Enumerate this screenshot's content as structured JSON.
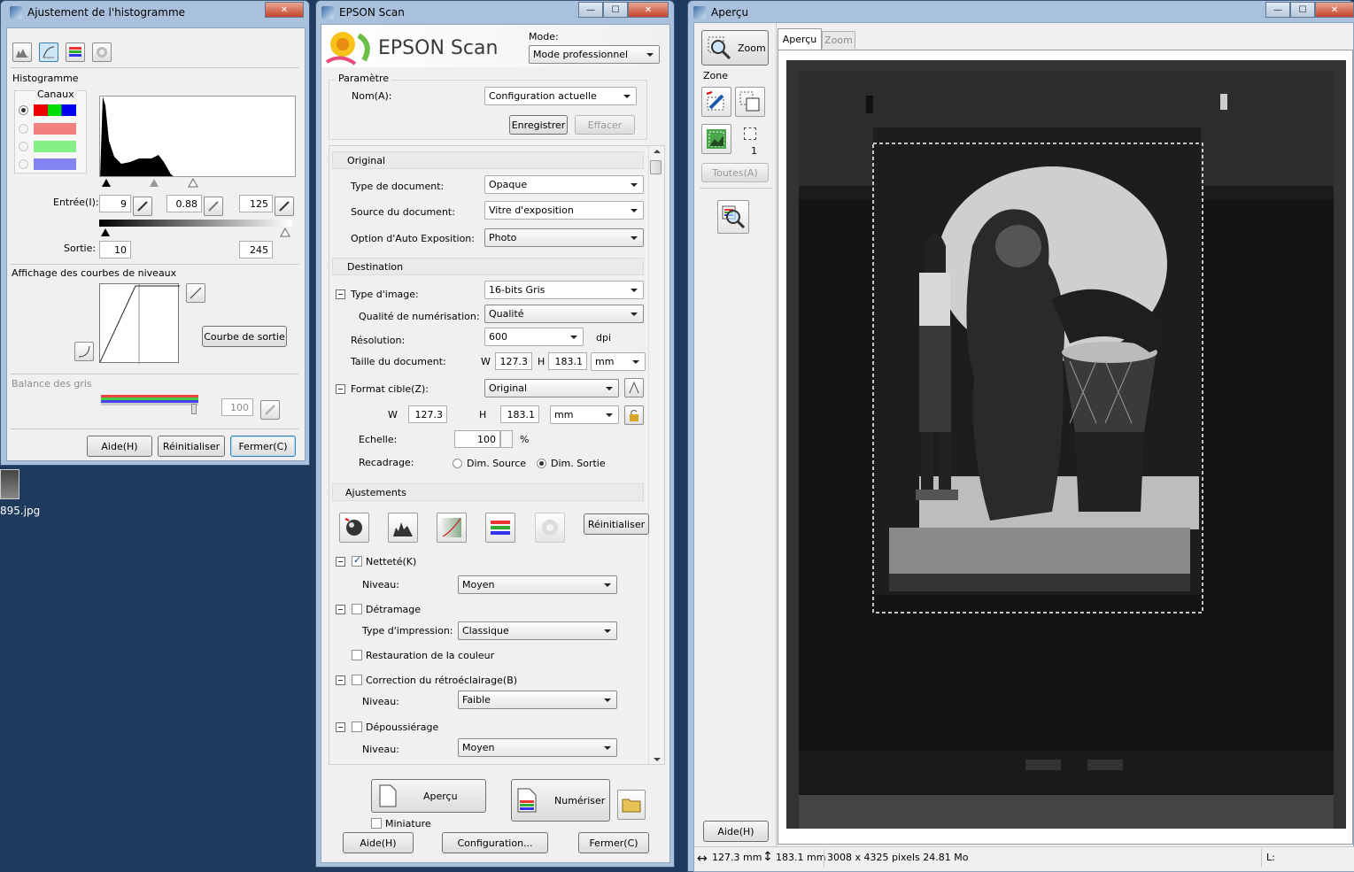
{
  "hist_window": {
    "title": "Ajustement de l'histogramme",
    "close_symbol": "✕",
    "toolbar_icons": [
      "histogram-icon",
      "tone-curve-icon",
      "color-balance-icon",
      "saturation-icon"
    ],
    "histogram_label": "Histogramme",
    "channels_label": "Canaux",
    "input_label": "Entrée(I):",
    "input_values": {
      "shadow": "9",
      "gamma": "0.88",
      "highlight": "125"
    },
    "output_label": "Sortie:",
    "output_values": {
      "low": "10",
      "high": "245"
    },
    "curve_section_label": "Affichage des courbes de niveaux",
    "output_curve_button": "Courbe de sortie",
    "gray_balance_label": "Balance des gris",
    "gray_balance_value": "100",
    "buttons": {
      "help": "Aide(H)",
      "reset": "Réinitialiser",
      "close": "Fermer(C)"
    }
  },
  "desktop": {
    "file_label": "895.jpg"
  },
  "epson_window": {
    "title": "EPSON Scan",
    "controls": {
      "minimize": "—",
      "maximize": "☐",
      "close": "✕"
    },
    "logo_text": "EPSON Scan",
    "mode_label": "Mode:",
    "mode_value": "Mode professionnel",
    "param_label": "Paramètre",
    "name_label": "Nom(A):",
    "name_value": "Configuration actuelle",
    "save_button": "Enregistrer",
    "delete_button": "Effacer",
    "original_section": "Original",
    "doc_type_label": "Type de document:",
    "doc_type_value": "Opaque",
    "doc_source_label": "Source du document:",
    "doc_source_value": "Vitre d'exposition",
    "auto_exposure_label": "Option d'Auto Exposition:",
    "auto_exposure_value": "Photo",
    "destination_section": "Destination",
    "image_type_label": "Type d'image:",
    "image_type_value": "16-bits Gris",
    "scan_quality_label": "Qualité de numérisation:",
    "scan_quality_value": "Qualité",
    "resolution_label": "Résolution:",
    "resolution_value": "600",
    "resolution_unit": "dpi",
    "doc_size_label": "Taille du document:",
    "w_label": "W",
    "h_label": "H",
    "doc_w": "127.3",
    "doc_h": "183.1",
    "unit_value": "mm",
    "target_format_label": "Format cible(Z):",
    "target_format_value": "Original",
    "target_w": "127.3",
    "target_h": "183.1",
    "target_unit": "mm",
    "scale_label": "Echelle:",
    "scale_value": "100",
    "scale_unit": "%",
    "crop_label": "Recadrage:",
    "crop_source": "Dim. Source",
    "crop_output": "Dim. Sortie",
    "adjust_section": "Ajustements",
    "reset_button": "Réinitialiser",
    "sharpness_label": "Netteté(K)",
    "sharp_level_label": "Niveau:",
    "sharp_level_value": "Moyen",
    "descreen_label": "Détramage",
    "print_type_label": "Type d'impression:",
    "print_type_value": "Classique",
    "color_restore_label": "Restauration de la couleur",
    "backlight_label": "Correction du rétroéclairage(B)",
    "backlight_level_label": "Niveau:",
    "backlight_level_value": "Faible",
    "dust_label": "Dépoussiérage",
    "dust_level_label": "Niveau:",
    "dust_level_value": "Moyen",
    "preview_button": "Aperçu",
    "thumbnail_label": "Miniature",
    "scan_button": "Numériser",
    "help_button": "Aide(H)",
    "config_button": "Configuration...",
    "close_button": "Fermer(C)"
  },
  "preview_window": {
    "title": "Aperçu",
    "controls": {
      "minimize": "—",
      "maximize": "☐",
      "close": "✕"
    },
    "zoom_button": "Zoom",
    "zone_label": "Zone",
    "marquee_count": "1",
    "all_button": "Toutes(A)",
    "tabs": {
      "preview": "Aperçu",
      "zoom": "Zoom"
    },
    "help_button": "Aide(H)",
    "status": {
      "width": "127.3 mm",
      "height": "183.1 mm",
      "info": "3008 x 4325 pixels 24.81 Mo",
      "l_label": "L:"
    }
  }
}
